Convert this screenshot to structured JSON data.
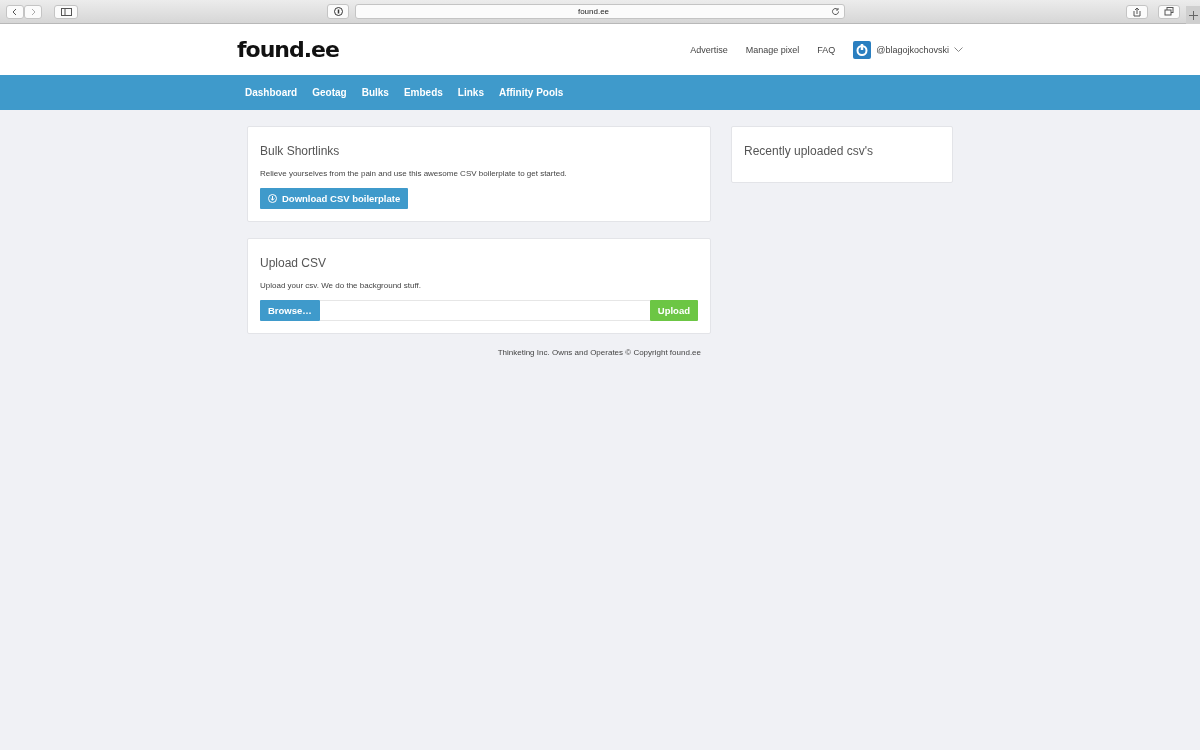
{
  "browser": {
    "url": "found.ee"
  },
  "header": {
    "logo": "found.ee",
    "links": [
      "Advertise",
      "Manage pixel",
      "FAQ"
    ],
    "user": "@blagojkochovski"
  },
  "nav": [
    {
      "label": "Dashboard"
    },
    {
      "label": "Geotag"
    },
    {
      "label": "Bulks"
    },
    {
      "label": "Embeds"
    },
    {
      "label": "Links"
    },
    {
      "label": "Affinity Pools"
    }
  ],
  "bulk_card": {
    "title": "Bulk Shortlinks",
    "text": "Relieve yourselves from the pain and use this awesome CSV boilerplate to get started.",
    "button": "Download CSV boilerplate"
  },
  "upload_card": {
    "title": "Upload CSV",
    "text": "Upload your csv. We do the background stuff.",
    "browse_button": "Browse…",
    "upload_button": "Upload"
  },
  "side_card": {
    "title": "Recently uploaded csv's"
  },
  "footer": "Thinketing Inc. Owns and Operates © Copyright found.ee"
}
